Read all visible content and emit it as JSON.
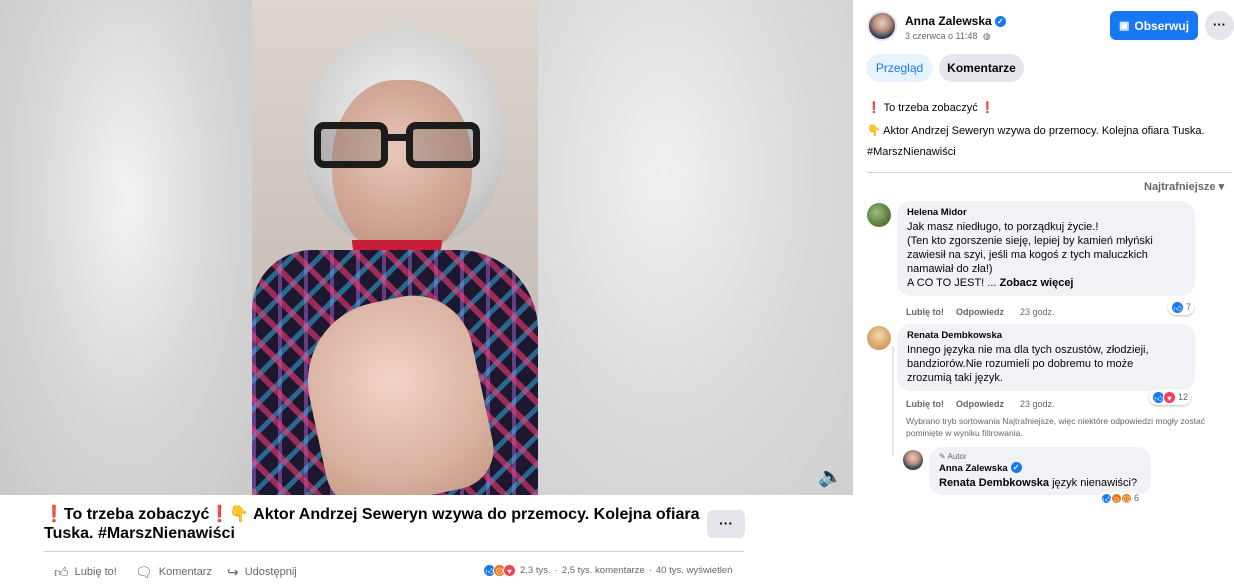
{
  "video": {
    "volume_icon": "speaker-icon"
  },
  "post": {
    "title_line1": "❗To trzeba zobaczyć❗👇 Aktor Andrzej Seweryn wzywa do przemocy. Kolejna ofiara",
    "title_line2": "Tuska. #MarszNienawiści",
    "more_label": "···",
    "actions": {
      "like": "Lubię to!",
      "comment": "Komentarz",
      "share": "Udostępnij"
    },
    "stats": {
      "reactions": "2,3 tys.",
      "comments": "2,5 tys. komentarze",
      "views": "40 tys. wyświetleń",
      "sep": "·"
    }
  },
  "panel": {
    "author": "Anna Zalewska",
    "verified_mark": "✓",
    "time": "3 czerwca o 11:48",
    "privacy_icon": "globe-icon",
    "follow_label": "Obserwuj",
    "dots_label": "···",
    "tabs": [
      "Przegląd",
      "Komentarze"
    ],
    "description": {
      "line1": "To trzeba zobaczyć",
      "line2": "Aktor Andrzej Seweryn wzywa do przemocy. Kolejna ofiara Tuska.",
      "line3": "#MarszNienawiści"
    },
    "sort_label": "Najtrafniejsze",
    "comments": [
      {
        "name": "Helena Midor",
        "lines": [
          "Jak masz niedługo, to porządkuj życie.!",
          "(Ten kto zgorszenie sieję, lepiej by kamień młyński",
          "zawiesił na szyi, jeśli ma kogoś z tych maluczkich",
          "namawiał do zła!)"
        ],
        "last_line": "A CO TO JEST! ... ",
        "see_more": "Zobacz więcej",
        "like": "Lubię to!",
        "reply": "Odpowiedz",
        "time": "23 godz.",
        "reaction_count": "7"
      },
      {
        "name": "Renata Dembkowska",
        "lines": [
          "Innego języka nie ma dla tych oszustów, złodzieji,",
          "bandziorów.Nie rozumieli po dobremu to może",
          "zrozumią taki język."
        ],
        "like": "Lubię to!",
        "reply": "Odpowiedz",
        "time": "23 godz.",
        "reaction_count": "12"
      }
    ],
    "filter_notice": "Wybrano tryb sortowania Najtrafniejsze, więc niektóre odpowiedzi mogły zostać pominięte w wyniku filtrowania.",
    "reply": {
      "author_tag": "Autor",
      "name": "Anna Zalewska",
      "mention": "Renata Dembkowska",
      "text": " język nienawiści?",
      "reaction_count": "6"
    }
  },
  "colors": {
    "accent": "#1877f2",
    "muted": "#65676b",
    "bubble": "#f0f2f5"
  }
}
